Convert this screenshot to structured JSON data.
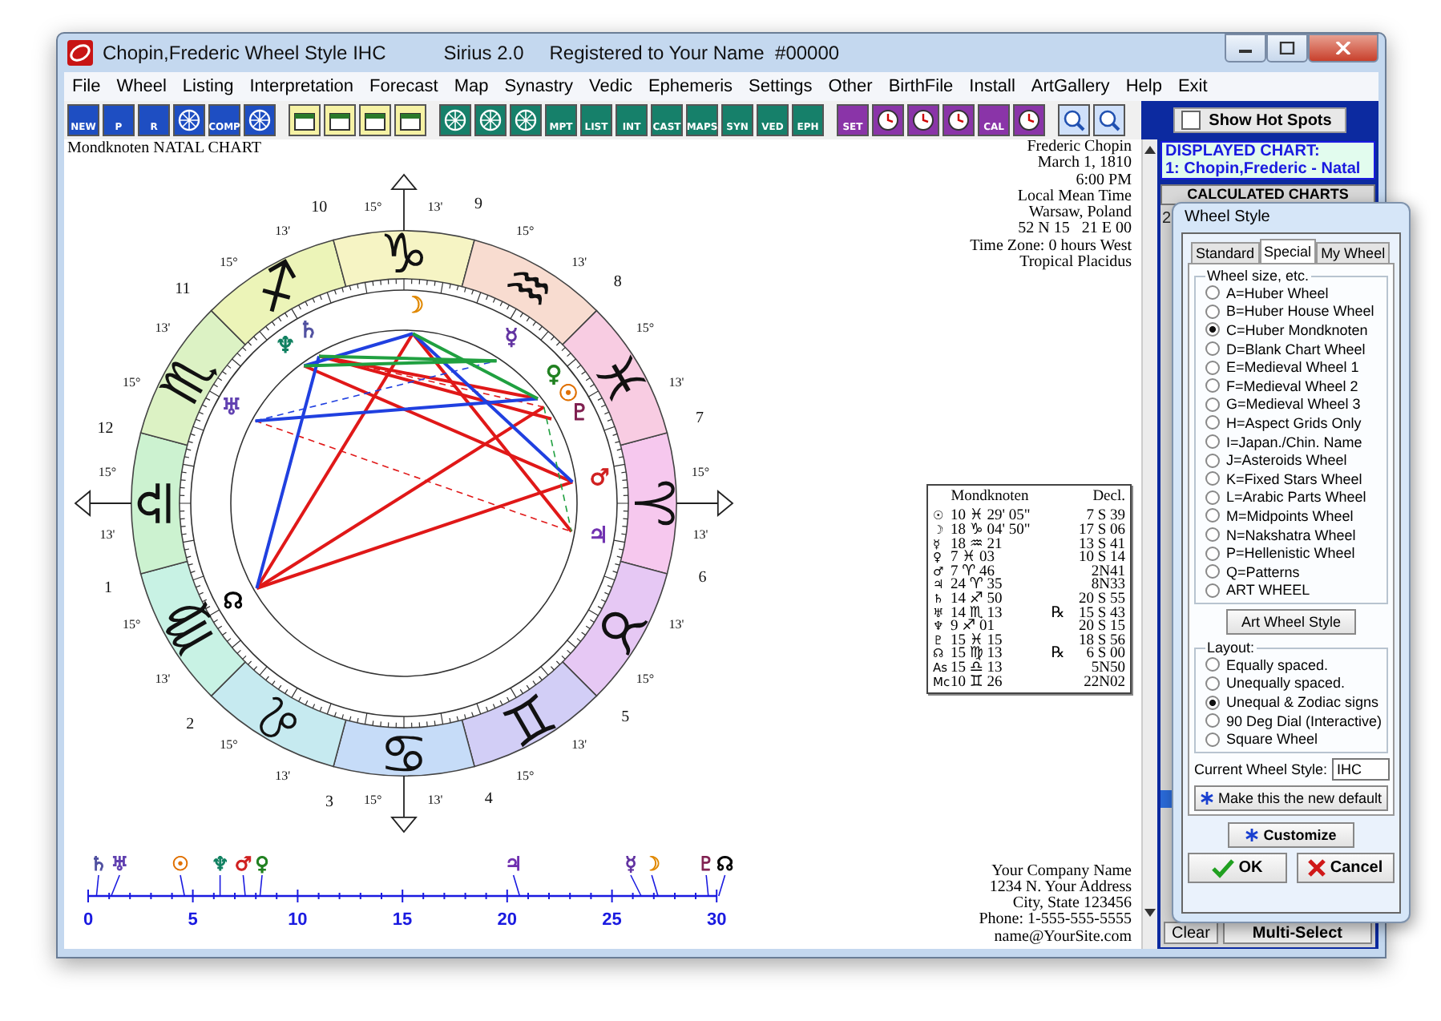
{
  "window": {
    "title": "Chopin,Frederic Wheel Style IHC",
    "app": "Sirius 2.0",
    "registration": "Registered to Your Name  #00000"
  },
  "menu": [
    "File",
    "Wheel",
    "Listing",
    "Interpretation",
    "Forecast",
    "Map",
    "Synastry",
    "Vedic",
    "Ephemeris",
    "Settings",
    "Other",
    "BirthFile",
    "Install",
    "ArtGallery",
    "Help",
    "Exit"
  ],
  "toolbar": [
    {
      "kind": "chart",
      "label": "NEW"
    },
    {
      "kind": "chart",
      "label": "P"
    },
    {
      "kind": "chart",
      "label": "R"
    },
    {
      "kind": "chart"
    },
    {
      "kind": "chart",
      "label": "COMP"
    },
    {
      "kind": "chart"
    },
    {
      "kind": "file"
    },
    {
      "kind": "file"
    },
    {
      "kind": "file"
    },
    {
      "kind": "file"
    },
    {
      "kind": "wheel"
    },
    {
      "kind": "wheel"
    },
    {
      "kind": "wheel"
    },
    {
      "kind": "wheel",
      "label": "MPT"
    },
    {
      "kind": "wheel",
      "label": "LIST"
    },
    {
      "kind": "wheel",
      "label": "INT"
    },
    {
      "kind": "wheel",
      "label": "CAST"
    },
    {
      "kind": "wheel",
      "label": "MAPS"
    },
    {
      "kind": "wheel",
      "label": "SYN"
    },
    {
      "kind": "wheel",
      "label": "VED"
    },
    {
      "kind": "wheel",
      "label": "EPH"
    },
    {
      "kind": "tool",
      "label": "SET"
    },
    {
      "kind": "tool"
    },
    {
      "kind": "tool"
    },
    {
      "kind": "tool"
    },
    {
      "kind": "tool",
      "label": "CAL"
    },
    {
      "kind": "tool"
    },
    {
      "kind": "zoom"
    },
    {
      "kind": "zoom"
    }
  ],
  "hot_spots": {
    "label": "Show Hot Spots",
    "checked": false
  },
  "chart": {
    "title": "Mondknoten NATAL CHART",
    "info": [
      "Frederic Chopin",
      "March 1, 1810",
      "6:00 PM",
      "Local Mean Time",
      "Warsaw, Poland",
      "52 N 15   21 E 00",
      "Time Zone: 0 hours West",
      "Tropical Placidus"
    ],
    "signs": [
      {
        "glyph": "♈",
        "color": "#f6c8ee"
      },
      {
        "glyph": "♉",
        "color": "#e6c8f4"
      },
      {
        "glyph": "♊",
        "color": "#d2cef6"
      },
      {
        "glyph": "♋",
        "color": "#c6dcf8"
      },
      {
        "glyph": "♌",
        "color": "#c6eaf0"
      },
      {
        "glyph": "♍",
        "color": "#c8f2e4"
      },
      {
        "glyph": "♎",
        "color": "#ccf2d0"
      },
      {
        "glyph": "♏",
        "color": "#dcf2c4"
      },
      {
        "glyph": "♐",
        "color": "#ecf4b8"
      },
      {
        "glyph": "♑",
        "color": "#f6f4c4"
      },
      {
        "glyph": "♒",
        "color": "#f8dcd0"
      },
      {
        "glyph": "♓",
        "color": "#f8cce2"
      }
    ],
    "houses": [
      "1",
      "2",
      "3",
      "4",
      "5",
      "6",
      "7",
      "8",
      "9",
      "10",
      "11",
      "12"
    ],
    "cusps": [
      {
        "degree": "15°",
        "minute": "13'"
      },
      {
        "degree": "15°",
        "minute": "13'"
      },
      {
        "degree": "15°",
        "minute": "13'"
      },
      {
        "degree": "15°",
        "minute": "13'"
      },
      {
        "degree": "15°",
        "minute": "13'"
      },
      {
        "degree": "15°",
        "minute": "13'"
      },
      {
        "degree": "15°",
        "minute": "13'"
      },
      {
        "degree": "15°",
        "minute": "13'"
      },
      {
        "degree": "15°",
        "minute": "13'"
      },
      {
        "degree": "15°",
        "minute": "13'"
      },
      {
        "degree": "15°",
        "minute": "13'"
      },
      {
        "degree": "15°",
        "minute": "13'"
      }
    ],
    "planets": [
      {
        "glyph": "☉",
        "color": "#e07000"
      },
      {
        "glyph": "☽",
        "color": "#e08800"
      },
      {
        "glyph": "☿",
        "color": "#6030a0"
      },
      {
        "glyph": "♀",
        "color": "#208020"
      },
      {
        "glyph": "♂",
        "color": "#d02020"
      },
      {
        "glyph": "♃",
        "color": "#7030b0"
      },
      {
        "glyph": "♄",
        "color": "#5050a0"
      },
      {
        "glyph": "♅",
        "color": "#6040b0"
      },
      {
        "glyph": "♆",
        "color": "#108060"
      },
      {
        "glyph": "♇",
        "color": "#802050"
      },
      {
        "glyph": "☊",
        "color": "#000000"
      }
    ],
    "table": {
      "columns": [
        "Mondknoten",
        "Decl."
      ],
      "rows": [
        {
          "glyph": "☉",
          "position": "10 ♓ 29' 05\"",
          "decl": "7 S 39"
        },
        {
          "glyph": "☽",
          "position": "18 ♑ 04' 50\"",
          "decl": "17 S 06"
        },
        {
          "glyph": "☿",
          "position": "18 ♒ 21",
          "decl": "13 S 41"
        },
        {
          "glyph": "♀",
          "position": "7 ♓ 03",
          "decl": "10 S 14"
        },
        {
          "glyph": "♂",
          "position": "7 ♈ 46",
          "decl": "2N41"
        },
        {
          "glyph": "♃",
          "position": "24 ♈ 35",
          "decl": "8N33"
        },
        {
          "glyph": "♄",
          "position": "14 ♐ 50",
          "decl": "20 S 55"
        },
        {
          "glyph": "♅",
          "position": "14 ♏ 13",
          "retro": "℞",
          "decl": "15 S 43"
        },
        {
          "glyph": "♆",
          "position": "9 ♐ 01",
          "decl": "20 S 15"
        },
        {
          "glyph": "♇",
          "position": "15 ♓ 15",
          "decl": "18 S 56"
        },
        {
          "glyph": "☊",
          "position": "15 ♍ 13",
          "retro": "℞",
          "decl": "6 S 00"
        },
        {
          "glyph": "As",
          "position": "15 ♎ 13",
          "decl": "5N50"
        },
        {
          "glyph": "Mc",
          "position": "10 ♊ 26",
          "decl": "22N02"
        }
      ]
    },
    "ruler": {
      "labels": [
        "0",
        "5",
        "10",
        "15",
        "20",
        "25",
        "30"
      ],
      "markers": [
        {
          "glyph": "♄",
          "color": "#5050a0"
        },
        {
          "glyph": "♅",
          "color": "#6040b0"
        },
        {
          "glyph": "☉",
          "color": "#e07000"
        },
        {
          "glyph": "♆",
          "color": "#108060"
        },
        {
          "glyph": "♂",
          "color": "#d02020"
        },
        {
          "glyph": "♀",
          "color": "#208020"
        },
        {
          "glyph": "♃",
          "color": "#7030b0"
        },
        {
          "glyph": "☿",
          "color": "#6030a0"
        },
        {
          "glyph": "☽",
          "color": "#e08800"
        },
        {
          "glyph": "♇",
          "color": "#802050"
        },
        {
          "glyph": "☊",
          "color": "#000000"
        }
      ]
    },
    "address": [
      "Your Company Name",
      "1234 N. Your Address",
      "City, State 123456",
      "Phone: 1-555-555-5555",
      "name@YourSite.com"
    ]
  },
  "side": {
    "displayed_title": "DISPLAYED CHART:",
    "displayed_chart": "1: Chopin,Frederic - Natal",
    "list_header": "CALCULATED CHARTS",
    "items": [
      {
        "text": "2",
        "selected": false
      },
      {
        "selected": true
      }
    ],
    "buttons": [
      "Clear",
      "Multi-Select"
    ]
  },
  "dialog": {
    "title": "Wheel Style",
    "tabs": [
      {
        "label": "Standard",
        "selected": false
      },
      {
        "label": "Special",
        "selected": true
      },
      {
        "label": "My Wheel",
        "selected": false
      }
    ],
    "size_group": {
      "title": "Wheel size, etc.",
      "options": [
        {
          "label": "A=Huber Wheel",
          "selected": false
        },
        {
          "label": "B=Huber House Wheel",
          "selected": false
        },
        {
          "label": "C=Huber Mondknoten",
          "selected": true
        },
        {
          "label": "D=Blank Chart Wheel",
          "selected": false
        },
        {
          "label": "E=Medieval Wheel 1",
          "selected": false
        },
        {
          "label": "F=Medieval Wheel 2",
          "selected": false
        },
        {
          "label": "G=Medieval Wheel 3",
          "selected": false
        },
        {
          "label": "H=Aspect Grids Only",
          "selected": false
        },
        {
          "label": "I=Japan./Chin. Name",
          "selected": false
        },
        {
          "label": "J=Asteroids Wheel",
          "selected": false
        },
        {
          "label": "K=Fixed Stars Wheel",
          "selected": false
        },
        {
          "label": "L=Arabic Parts Wheel",
          "selected": false
        },
        {
          "label": "M=Midpoints Wheel",
          "selected": false
        },
        {
          "label": "N=Nakshatra Wheel",
          "selected": false
        },
        {
          "label": "P=Hellenistic Wheel",
          "selected": false
        },
        {
          "label": "Q=Patterns",
          "selected": false
        },
        {
          "label": "ART WHEEL",
          "selected": false
        }
      ]
    },
    "art_button": "Art Wheel Style",
    "layout_group": {
      "title": "Layout:",
      "options": [
        {
          "label": "Equally spaced.",
          "selected": false
        },
        {
          "label": "Unequally spaced.",
          "selected": false
        },
        {
          "label": "Unequal & Zodiac signs",
          "selected": true
        },
        {
          "label": "90 Deg Dial (Interactive)",
          "selected": false
        },
        {
          "label": "Square Wheel",
          "selected": false
        }
      ]
    },
    "current_label": "Current Wheel Style:",
    "current_value": "IHC",
    "default_button": "Make this the new default",
    "customize_button": "Customize",
    "ok_button": "OK",
    "cancel_button": "Cancel"
  }
}
